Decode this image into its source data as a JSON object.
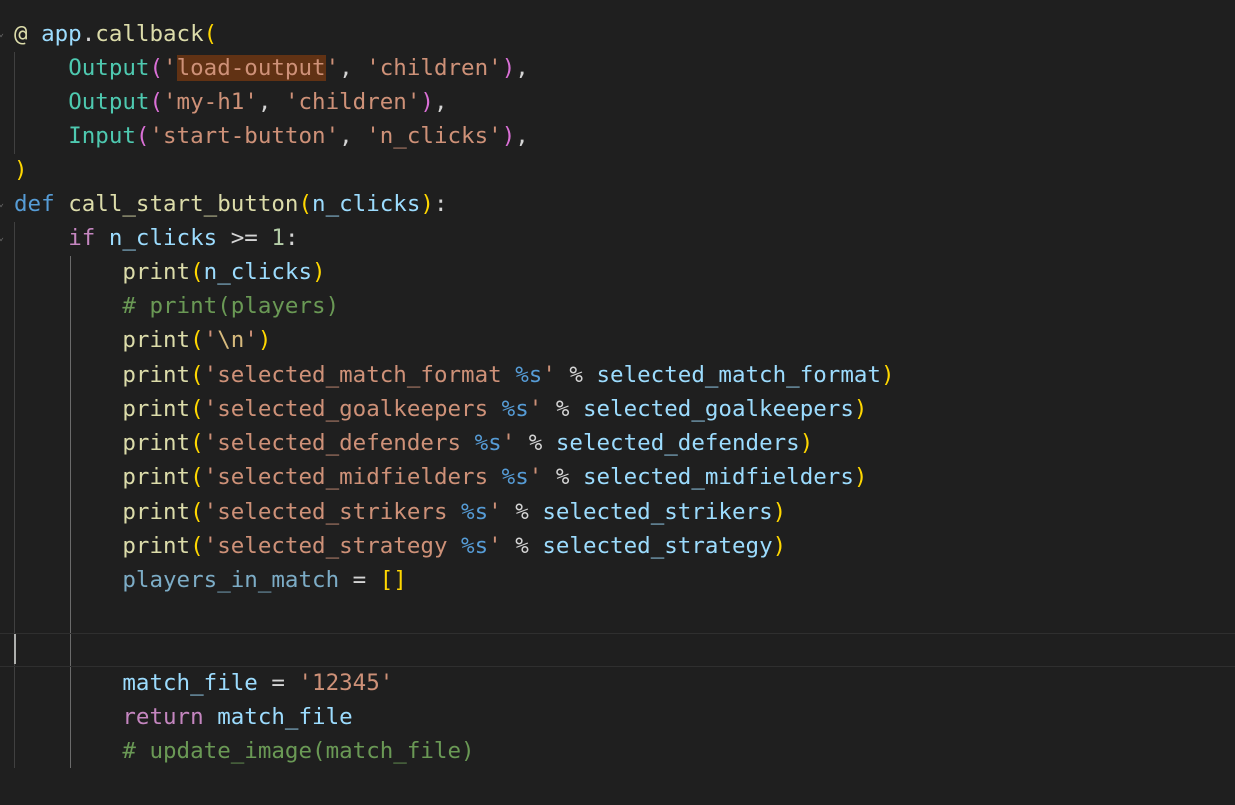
{
  "code": {
    "l1": {
      "at": "@",
      "app": "app",
      "dot": ".",
      "callback": "callback",
      "paren": "("
    },
    "l2": {
      "fn": "Output",
      "p": "(",
      "q1": "'",
      "s": "load-output",
      "q2": "'",
      "sep": ", ",
      "s2": "'children'",
      "p2": ")",
      "end": ","
    },
    "l3": {
      "fn": "Output",
      "p": "(",
      "s": "'my-h1'",
      "sep": ", ",
      "s2": "'children'",
      "p2": ")",
      "end": ","
    },
    "l4": {
      "fn": "Input",
      "p": "(",
      "s": "'start-button'",
      "sep": ", ",
      "s2": "'n_clicks'",
      "p2": ")",
      "end": ","
    },
    "l5": {
      "p": ")"
    },
    "l6": {
      "def": "def",
      "name": "call_start_button",
      "p": "(",
      "arg": "n_clicks",
      "p2": ")",
      "colon": ":"
    },
    "l7": {
      "kw": "if",
      "var": "n_clicks",
      "op": " >= ",
      "num": "1",
      "colon": ":"
    },
    "l8": {
      "fn": "print",
      "p": "(",
      "arg": "n_clicks",
      "p2": ")"
    },
    "l9": {
      "cmt": "# print(players)"
    },
    "l10": {
      "fn": "print",
      "p": "(",
      "q1": "'",
      "esc": "\\n",
      "q2": "'",
      "p2": ")"
    },
    "l11": {
      "fn": "print",
      "p": "(",
      "s": "'selected_match_format ",
      "f": "%s",
      "q": "'",
      "op": " % ",
      "arg": "selected_match_format",
      "p2": ")"
    },
    "l12": {
      "fn": "print",
      "p": "(",
      "s": "'selected_goalkeepers ",
      "f": "%s",
      "q": "'",
      "op": " % ",
      "arg": "selected_goalkeepers",
      "p2": ")"
    },
    "l13": {
      "fn": "print",
      "p": "(",
      "s": "'selected_defenders ",
      "f": "%s",
      "q": "'",
      "op": " % ",
      "arg": "selected_defenders",
      "p2": ")"
    },
    "l14": {
      "fn": "print",
      "p": "(",
      "s": "'selected_midfielders ",
      "f": "%s",
      "q": "'",
      "op": " % ",
      "arg": "selected_midfielders",
      "p2": ")"
    },
    "l15": {
      "fn": "print",
      "p": "(",
      "s": "'selected_strikers ",
      "f": "%s",
      "q": "'",
      "op": " % ",
      "arg": "selected_strikers",
      "p2": ")"
    },
    "l16": {
      "fn": "print",
      "p": "(",
      "s": "'selected_strategy ",
      "f": "%s",
      "q": "'",
      "op": " % ",
      "arg": "selected_strategy",
      "p2": ")"
    },
    "l17": {
      "var": "players_in_match",
      "op": " = ",
      "br": "[]"
    },
    "l20": {
      "var": "match_file",
      "op": " = ",
      "s": "'12345'"
    },
    "l21": {
      "kw": "return",
      "var": "match_file"
    },
    "l22": {
      "cmt": "# update_image(match_file)"
    }
  },
  "icons": {
    "fold": "chevron-down-icon"
  },
  "colors": {
    "background": "#1f1f1f",
    "keyword": "#569cd6",
    "function": "#dcdcaa",
    "string": "#ce9178",
    "comment": "#6a9955",
    "variable": "#9cdcfe"
  }
}
